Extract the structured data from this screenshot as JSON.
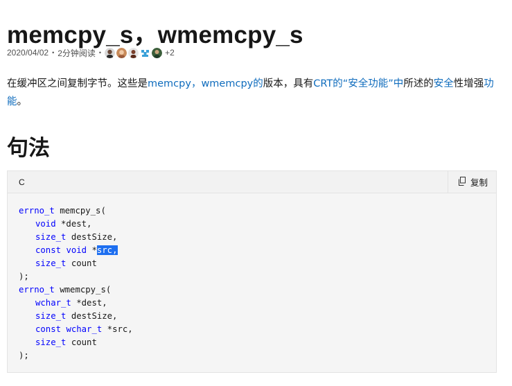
{
  "title": "memcpy_s，wmemcpy_s",
  "meta": {
    "date": "2020/04/02",
    "read_time": "2分钟阅读",
    "contributors_more": "+2",
    "avatars": [
      "contributor-avatar-1",
      "contributor-avatar-2",
      "contributor-avatar-3",
      "contributor-avatar-4",
      "contributor-avatar-5"
    ]
  },
  "intro": {
    "p1": "在缓冲区之间复制字节。这些是",
    "link_memcpy": "memcpy",
    "comma": "，",
    "link_wmemcpy": "wmemcpy的",
    "p2": "版本，具有",
    "link_crt": "CRT的",
    "link_security_features": "“安全功能”",
    "link_zhong": "中",
    "p3": "所述的",
    "link_security": "安全",
    "p4": "性增强",
    "link_features": "功能",
    "p5": "。"
  },
  "syntax_heading": "句法",
  "code": {
    "language": "C",
    "copy_label": "复制",
    "lines": {
      "l1_type": "errno_t",
      "l1_rest": " memcpy_s(",
      "l2_type": "void",
      "l2_rest": " *dest,",
      "l3_type": "size_t",
      "l3_rest": " destSize,",
      "l4_kw": "const",
      "l4_type": "void",
      "l4_pre": " *",
      "l4_sel": "src,",
      "l5_type": "size_t",
      "l5_rest": " count",
      "l6": ");",
      "l7_type": "errno_t",
      "l7_rest": " wmemcpy_s(",
      "l8_type": "wchar_t",
      "l8_rest": " *dest,",
      "l9_type": "size_t",
      "l9_rest": " destSize,",
      "l10_kw": "const",
      "l10_type": "wchar_t",
      "l10_rest": " *src,",
      "l11_type": "size_t",
      "l11_rest": " count",
      "l12": ");"
    }
  },
  "colors": {
    "link": "#0f6cbd",
    "keyword": "#0101fd",
    "selection": "#1e6ff0",
    "code_bg": "#f5f5f5"
  }
}
